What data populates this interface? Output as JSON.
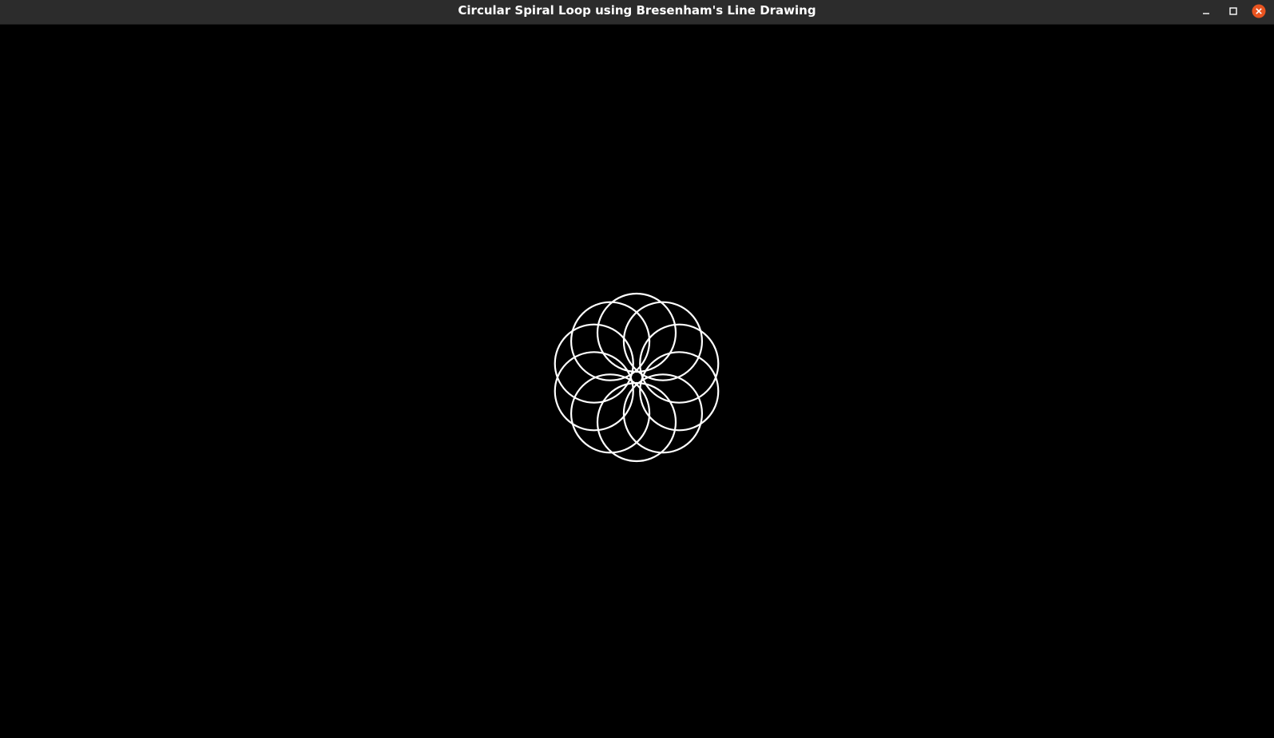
{
  "window": {
    "title": "Circular Spiral Loop using Bresenham's Line Drawing"
  },
  "controls": {
    "minimize_icon": "minimize-icon",
    "maximize_icon": "maximize-icon",
    "close_icon": "close-icon"
  },
  "colors": {
    "titlebar_bg": "#2c2c2c",
    "canvas_bg": "#000000",
    "stroke": "#ffffff",
    "close_button": "#e95420"
  },
  "drawing": {
    "shape": "circle loop",
    "loop_count": 10
  }
}
